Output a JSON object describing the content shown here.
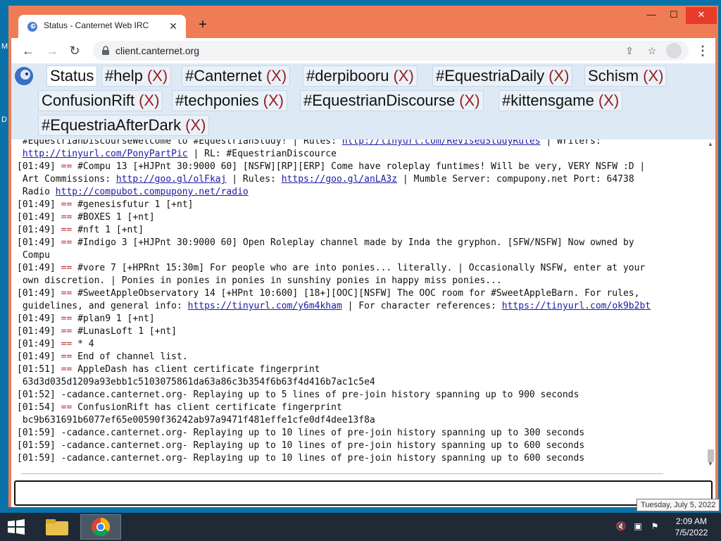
{
  "desktop": {
    "left_letter_top": "M",
    "left_letter_bottom": "D"
  },
  "browser": {
    "tab_title": "Status - Canternet Web IRC",
    "tab_close": "✕",
    "new_tab": "+",
    "url": "client.canternet.org",
    "window_controls": {
      "minimize": "—",
      "maximize": "☐",
      "close": "✕"
    }
  },
  "channels": [
    {
      "name": "Status",
      "close": ""
    },
    {
      "name": "#help",
      "close": "(X)"
    },
    {
      "name": "#Canternet",
      "close": "(X)"
    },
    {
      "name": "#derpibooru",
      "close": "(X)"
    },
    {
      "name": "#EquestriaDaily",
      "close": "(X)"
    },
    {
      "name": "Schism",
      "close": "(X)"
    },
    {
      "name": "ConfusionRift",
      "close": "(X)"
    },
    {
      "name": "#techponies",
      "close": "(X)"
    },
    {
      "name": "#EquestrianDiscourse",
      "close": "(X)"
    },
    {
      "name": "#kittensgame",
      "close": "(X)"
    },
    {
      "name": "#EquestriaAfterDark",
      "close": "(X)"
    }
  ],
  "log": [
    {
      "t": " #EquestrianDiscourseWelcome to #EquestrianStudy! | Rules: ",
      "link": "http://tinyurl.com/RevisedStudyRules",
      "t2": " | Writers:"
    },
    {
      "t": " ",
      "link": "http://tinyurl.com/PonyPartPic",
      "t2": " | RL: #EquestrianDiscource"
    },
    {
      "ts": "[01:49]",
      "eq": "==",
      "t": " #Compu 13 [+HJPnt 30:9000 60] [NSFW][RP][ERP] Come have roleplay funtimes! Will be very, VERY NSFW :D |"
    },
    {
      "t": " Art Commissions: ",
      "link": "http://goo.gl/olFkaj",
      "t2": " | Rules: ",
      "link2": "https://goo.gl/anLA3z",
      "t3": " | Mumble Server: compupony.net Port: 64738"
    },
    {
      "t": " Radio ",
      "link": "http://compubot.compupony.net/radio"
    },
    {
      "ts": "[01:49]",
      "eq": "==",
      "t": " #genesisfutur 1 [+nt]"
    },
    {
      "ts": "[01:49]",
      "eq": "==",
      "t": " #BOXES 1 [+nt]"
    },
    {
      "ts": "[01:49]",
      "eq": "==",
      "t": " #nft 1 [+nt]"
    },
    {
      "ts": "[01:49]",
      "eq": "==",
      "t": " #Indigo 3 [+HJPnt 30:9000 60] Open Roleplay channel made by Inda the gryphon. [SFW/NSFW] Now owned by"
    },
    {
      "t": " Compu"
    },
    {
      "ts": "[01:49]",
      "eq": "==",
      "t": " #vore 7 [+HPRnt 15:30m] For people who are into ponies... literally. | Occasionally NSFW, enter at your"
    },
    {
      "t": " own discretion. | Ponies in ponies in ponies in sunshiny ponies in happy miss ponies..."
    },
    {
      "ts": "[01:49]",
      "eq": "==",
      "t": " #SweetAppleObservatory 14 [+HPnt 10:600] [18+][OOC][NSFW] The OOC room for #SweetAppleBarn. For rules,"
    },
    {
      "t": " guidelines, and general info: ",
      "link": "https://tinyurl.com/y6m4kham",
      "t2": " | For character references: ",
      "link2": "https://tinyurl.com/ok9b2bt"
    },
    {
      "ts": "[01:49]",
      "eq": "==",
      "t": " #plan9 1 [+nt]"
    },
    {
      "ts": "[01:49]",
      "eq": "==",
      "t": " #LunasLoft 1 [+nt]"
    },
    {
      "ts": "[01:49]",
      "eq": "==",
      "t": " * 4"
    },
    {
      "ts": "[01:49]",
      "eq": "==",
      "t": " End of channel list."
    },
    {
      "ts": "[01:51]",
      "eq": "==",
      "t": " AppleDash has client certificate fingerprint"
    },
    {
      "t": " 63d3d035d1209a93ebb1c5103075861da63a86c3b354f6b63f4d416b7ac1c5e4"
    },
    {
      "ts": "[01:52]",
      "t": " -cadance.canternet.org- Replaying up to 5 lines of pre-join history spanning up to 900 seconds"
    },
    {
      "ts": "[01:54]",
      "eq": "==",
      "t": " ConfusionRift has client certificate fingerprint"
    },
    {
      "t": " bc9b631691b6077ef65e00590f36242ab97a9471f481effe1cfe0df4dee13f8a"
    },
    {
      "ts": "[01:59]",
      "t": " -cadance.canternet.org- Replaying up to 10 lines of pre-join history spanning up to 300 seconds"
    },
    {
      "ts": "[01:59]",
      "t": " -cadance.canternet.org- Replaying up to 10 lines of pre-join history spanning up to 600 seconds"
    },
    {
      "ts": "[01:59]",
      "t": " -cadance.canternet.org- Replaying up to 10 lines of pre-join history spanning up to 600 seconds"
    }
  ],
  "input": {
    "value": ""
  },
  "taskbar": {
    "time": "2:09 AM",
    "date": "7/5/2022",
    "tooltip": "Tuesday, July 5, 2022"
  },
  "colors": {
    "accent": "#f07c55",
    "link": "#1a1aa6",
    "system_eq": "#c0282c",
    "close_x": "#9a1d1d"
  }
}
